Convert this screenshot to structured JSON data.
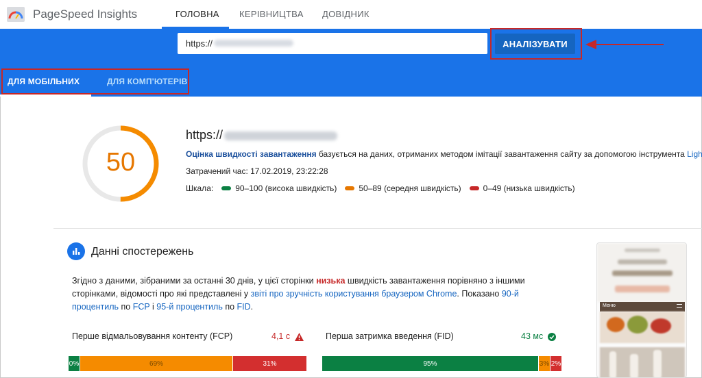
{
  "app": {
    "title": "PageSpeed Insights"
  },
  "nav": {
    "tabs": [
      {
        "label": "ГОЛОВНА"
      },
      {
        "label": "КЕРІВНИЦТВА"
      },
      {
        "label": "ДОВІДНИК"
      }
    ]
  },
  "search": {
    "url_value": "https://",
    "analyze_label": "АНАЛІЗУВАТИ"
  },
  "device_tabs": [
    {
      "label": "ДЛЯ МОБІЛЬНИХ"
    },
    {
      "label": "ДЛЯ КОМП'ЮТЕРІВ"
    }
  ],
  "score": {
    "value": "50",
    "fraction": 0.5,
    "url_prefix": "https://",
    "desc_link": "Оцінка швидкості завантаження",
    "desc_text": " базується на даних, отриманих методом імітації завантаження сайту за допомогою інструмента ",
    "desc_tool": "Lighthouse",
    "time_label": "Затрачений час: 17.02.2019, 23:22:28",
    "scale_label": "Шкала:",
    "scale_items": [
      {
        "label": "90–100 (висока швидкість)",
        "color": "#0b8043"
      },
      {
        "label": "50–89 (середня швидкість)",
        "color": "#e67700"
      },
      {
        "label": "0–49 (низька швидкість)",
        "color": "#c62828"
      }
    ]
  },
  "field_data": {
    "title": "Данні спостережень",
    "text_1": "Згідно з даними, зібраними за останні 30 днів, у цієї сторінки ",
    "text_low": "низька",
    "text_2": " швидкість завантаження порівняно з іншими сторінками, відомості про які представлені у ",
    "text_link": "звіті про зручність користування браузером Chrome",
    "text_3": ". Показано ",
    "text_p90": "90-й процентиль",
    "text_4": " по ",
    "text_fcp": "FCP",
    "text_5": " і ",
    "text_p95": "95-й процентиль",
    "text_6": " по ",
    "text_fid": "FID",
    "text_7": "."
  },
  "metrics": [
    {
      "name": "Перше відмальовування контенту (FCP)",
      "value": "4,1 с",
      "status_color": "#c62828",
      "distribution": [
        {
          "label": "0%",
          "fraction": 0.0,
          "color": "#0b8043"
        },
        {
          "label": "69%",
          "fraction": 0.69,
          "color": "#f58b00"
        },
        {
          "label": "31%",
          "fraction": 0.31,
          "color": "#d32f2f"
        }
      ]
    },
    {
      "name": "Перша затримка введення (FID)",
      "value": "43 мс",
      "status_color": "#0b8043",
      "distribution": [
        {
          "label": "95%",
          "fraction": 0.95,
          "color": "#0b8043"
        },
        {
          "label": "3%",
          "fraction": 0.03,
          "color": "#f58b00"
        },
        {
          "label": "2%",
          "fraction": 0.02,
          "color": "#d32f2f"
        }
      ]
    }
  ],
  "phone_preview": {
    "header_label": "Меню"
  }
}
